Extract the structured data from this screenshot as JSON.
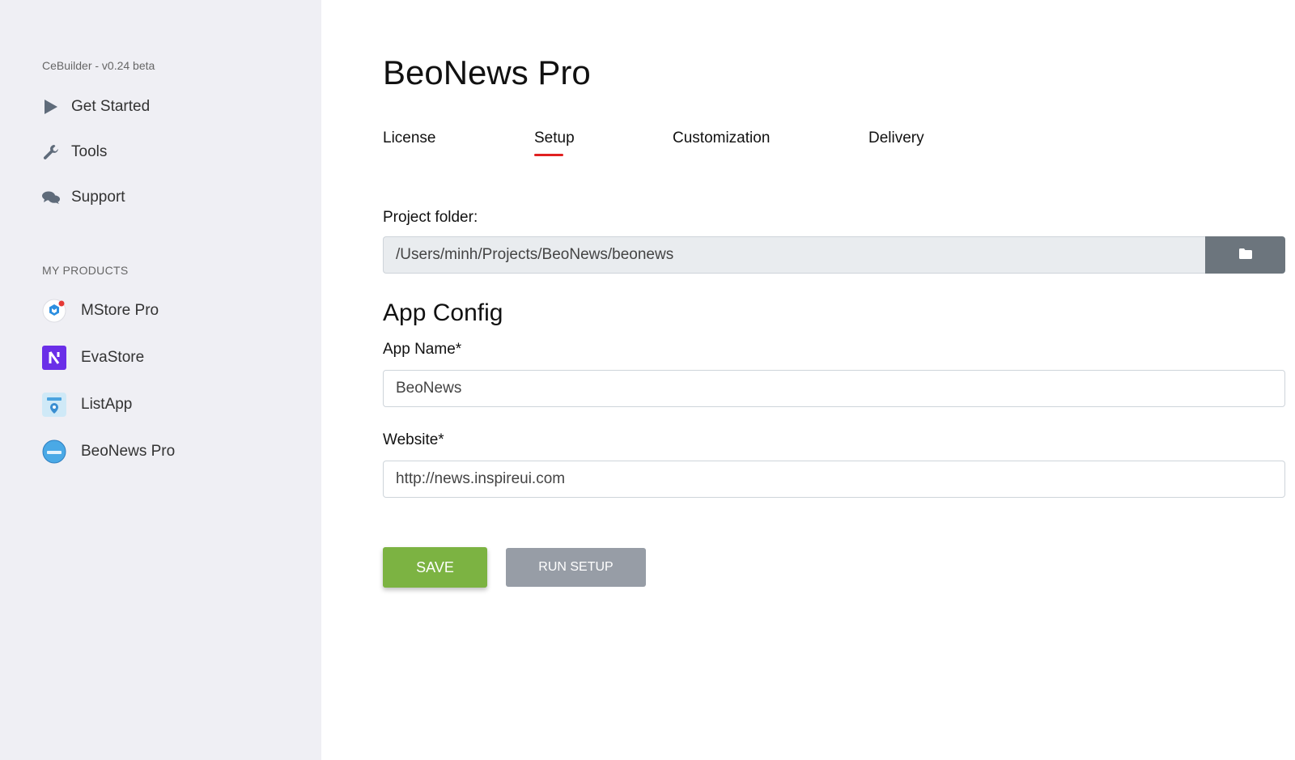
{
  "sidebar": {
    "version": "CeBuilder - v0.24 beta",
    "nav": [
      {
        "label": "Get Started",
        "icon": "play-icon"
      },
      {
        "label": "Tools",
        "icon": "wrench-icon"
      },
      {
        "label": "Support",
        "icon": "chat-bubbles-icon"
      }
    ],
    "section_label": "MY PRODUCTS",
    "products": [
      {
        "label": "MStore Pro",
        "icon": "mstore-logo-icon"
      },
      {
        "label": "EvaStore",
        "icon": "evastore-logo-icon"
      },
      {
        "label": "ListApp",
        "icon": "listapp-logo-icon"
      },
      {
        "label": "BeoNews Pro",
        "icon": "beonews-logo-icon"
      }
    ]
  },
  "main": {
    "title": "BeoNews Pro",
    "tabs": [
      {
        "label": "License",
        "active": false
      },
      {
        "label": "Setup",
        "active": true
      },
      {
        "label": "Customization",
        "active": false
      },
      {
        "label": "Delivery",
        "active": false
      }
    ],
    "project_folder": {
      "label": "Project folder:",
      "value": "/Users/minh/Projects/BeoNews/beonews",
      "button_icon": "folder-icon"
    },
    "app_config": {
      "title": "App Config",
      "app_name_label": "App Name*",
      "app_name_value": "BeoNews",
      "website_label": "Website*",
      "website_value": "http://news.inspireui.com"
    },
    "buttons": {
      "save": "SAVE",
      "run_setup": "RUN SETUP"
    }
  },
  "colors": {
    "sidebar_bg": "#efeff4",
    "tab_active_underline": "#e02020",
    "save_button": "#7cb342",
    "run_setup_button": "#979da6",
    "folder_button": "#6c757d"
  }
}
